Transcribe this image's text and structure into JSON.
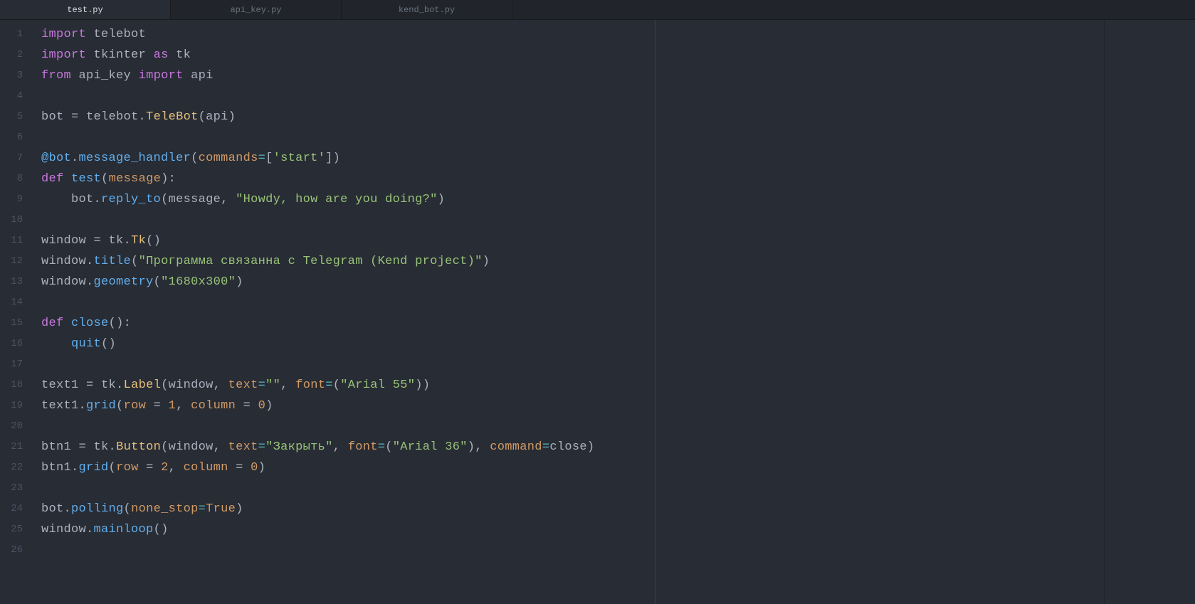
{
  "tabs": [
    {
      "label": "test.py",
      "active": true
    },
    {
      "label": "api_key.py",
      "active": false
    },
    {
      "label": "kend_bot.py",
      "active": false
    }
  ],
  "lines": {
    "n1": "1",
    "n2": "2",
    "n3": "3",
    "n4": "4",
    "n5": "5",
    "n6": "6",
    "n7": "7",
    "n8": "8",
    "n9": "9",
    "n10": "10",
    "n11": "11",
    "n12": "12",
    "n13": "13",
    "n14": "14",
    "n15": "15",
    "n16": "16",
    "n17": "17",
    "n18": "18",
    "n19": "19",
    "n20": "20",
    "n21": "21",
    "n22": "22",
    "n23": "23",
    "n24": "24",
    "n25": "25",
    "n26": "26"
  },
  "tok": {
    "import": "import",
    "from": "from",
    "as": "as",
    "def": "def",
    "telebot": "telebot",
    "tkinter": "tkinter",
    "tk": "tk",
    "api_key": "api_key",
    "api": "api",
    "bot": "bot",
    "TeleBot": "TeleBot",
    "at_bot": "@bot",
    "message_handler": "message_handler",
    "commands": "commands",
    "start_str": "'start'",
    "test": "test",
    "message": "message",
    "reply_to": "reply_to",
    "howdy": "\"Howdy, how are you doing?\"",
    "window": "window",
    "Tk": "Tk",
    "title": "title",
    "title_str": "\"Программа связанна с Telegram (Kend project)\"",
    "geometry": "geometry",
    "geo_str": "\"1680x300\"",
    "close": "close",
    "quit": "quit",
    "text1": "text1",
    "Label": "Label",
    "text_kw": "text",
    "empty_str": "\"\"",
    "font_kw": "font",
    "arial55": "\"Arial 55\"",
    "grid": "grid",
    "row_kw": "row",
    "column_kw": "column",
    "btn1": "btn1",
    "Button": "Button",
    "close_str": "\"Закрыть\"",
    "arial36": "\"Arial 36\"",
    "command_kw": "command",
    "polling": "polling",
    "none_stop": "none_stop",
    "True": "True",
    "mainloop": "mainloop",
    "one": "1",
    "two": "2",
    "zero": "0",
    "eq": "=",
    "eq_sp": " = ",
    "dot": ".",
    "comma_sp": ", ",
    "colon": ":",
    "lp": "(",
    "rp": ")",
    "lb": "[",
    "rb": "]",
    "indent": "    "
  }
}
